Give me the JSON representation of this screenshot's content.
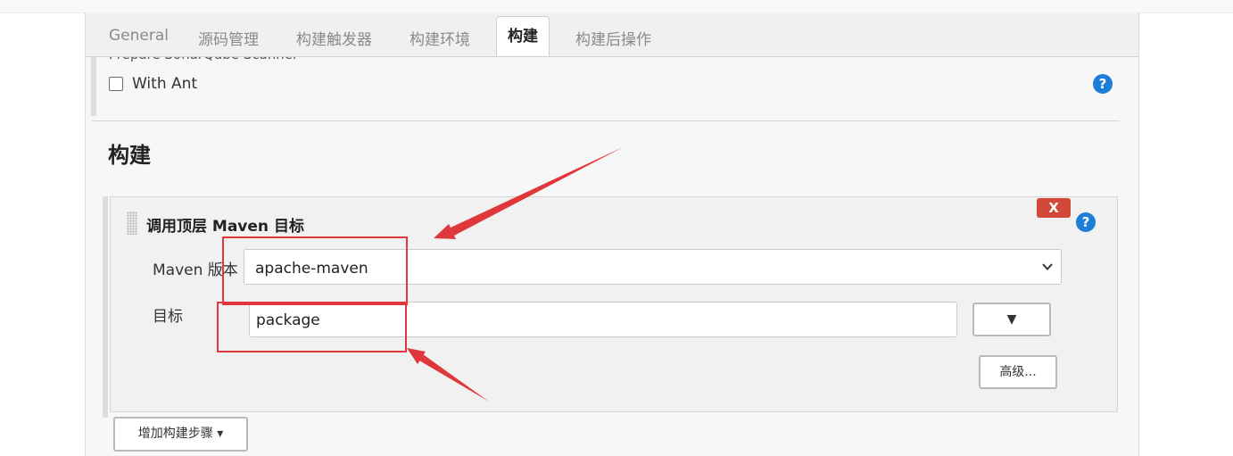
{
  "tabs": [
    {
      "label": "General"
    },
    {
      "label": "源码管理"
    },
    {
      "label": "构建触发器"
    },
    {
      "label": "构建环境"
    },
    {
      "label": "构建"
    },
    {
      "label": "构建后操作"
    }
  ],
  "active_tab": "构建",
  "prev_section": {
    "checkbox_label": "With Ant",
    "checked": false
  },
  "build_section": {
    "title": "构建",
    "step": {
      "title": "调用顶层 Maven 目标",
      "delete_label": "X",
      "maven_version_label": "Maven 版本",
      "maven_version_value": "apache-maven",
      "goals_label": "目标",
      "goals_value": "package",
      "expand_button": "▼",
      "advanced_button": "高级..."
    },
    "add_step_button": "增加构建步骤 ▾"
  },
  "help_label": "?",
  "colors": {
    "annotation_red": "#e0373a",
    "help_blue": "#1c7ed6",
    "delete_red": "#d24939"
  }
}
